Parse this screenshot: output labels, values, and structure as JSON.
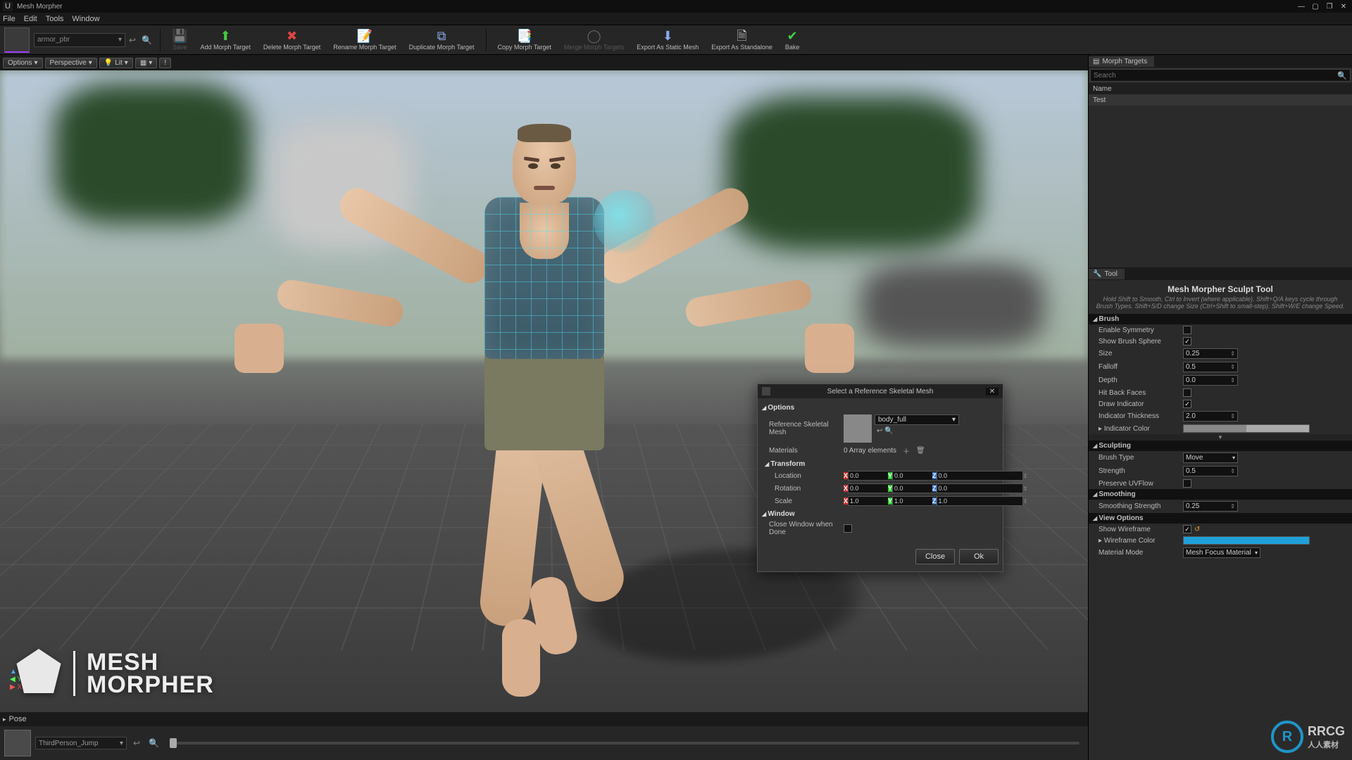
{
  "window": {
    "title": "Mesh Morpher"
  },
  "menubar": {
    "file": "File",
    "edit": "Edit",
    "tools": "Tools",
    "window": "Window"
  },
  "asset": {
    "name": "armor_pbr"
  },
  "toolbar": {
    "save": "Save",
    "add": "Add Morph Target",
    "delete": "Delete Morph Target",
    "rename": "Rename Morph Target",
    "duplicate": "Duplicate Morph Target",
    "copy": "Copy Morph Target",
    "merge": "Merge Morph Targets",
    "export_static": "Export As Static Mesh",
    "export_standalone": "Export As Standalone",
    "bake": "Bake"
  },
  "viewport_bar": {
    "options": "Options",
    "perspective": "Perspective",
    "lit": "Lit"
  },
  "overlay": {
    "logo_line1": "MESH",
    "logo_line2": "MORPHER",
    "axis_z": "Z",
    "axis_y": "Y",
    "axis_x": "X"
  },
  "pose": {
    "label": "Pose"
  },
  "timeline": {
    "anim": "ThirdPerson_Jump"
  },
  "dialog": {
    "title": "Select a Reference Skeletal Mesh",
    "section_options": "Options",
    "ref_label": "Reference Skeletal Mesh",
    "ref_value": "body_full",
    "materials_label": "Materials",
    "materials_value": "0 Array elements",
    "transform_label": "Transform",
    "location_label": "Location",
    "rotation_label": "Rotation",
    "scale_label": "Scale",
    "loc": {
      "x": "0.0",
      "y": "0.0",
      "z": "0.0"
    },
    "rot": {
      "x": "0.0",
      "y": "0.0",
      "z": "0.0"
    },
    "scl": {
      "x": "1.0",
      "y": "1.0",
      "z": "1.0"
    },
    "section_window": "Window",
    "close_done": "Close Window when Done",
    "btn_close": "Close",
    "btn_ok": "Ok"
  },
  "morph_targets": {
    "tab": "Morph Targets",
    "search_placeholder": "Search",
    "column": "Name",
    "items": [
      "Test"
    ]
  },
  "tool_panel": {
    "tab": "Tool",
    "title": "Mesh Morpher Sculpt Tool",
    "hint": "Hold Shift to Smooth, Ctrl to Invert (where applicable). Shift+Q/A keys cycle through Brush Types. Shift+S/D change Size (Ctrl+Shift to small-step). Shift+W/E change Speed.",
    "brush_section": "Brush",
    "enable_symmetry": "Enable Symmetry",
    "show_brush_sphere": "Show Brush Sphere",
    "size_label": "Size",
    "size_value": "0.25",
    "falloff_label": "Falloff",
    "falloff_value": "0.5",
    "depth_label": "Depth",
    "depth_value": "0.0",
    "hit_back_faces": "Hit Back Faces",
    "draw_indicator": "Draw Indicator",
    "indicator_thickness_label": "Indicator Thickness",
    "indicator_thickness_value": "2.0",
    "indicator_color_label": "Indicator Color",
    "sculpting_section": "Sculpting",
    "brush_type_label": "Brush Type",
    "brush_type_value": "Move",
    "strength_label": "Strength",
    "strength_value": "0.5",
    "preserve_uvflow": "Preserve UVFlow",
    "smoothing_section": "Smoothing",
    "smoothing_strength_label": "Smoothing Strength",
    "smoothing_strength_value": "0.25",
    "view_section": "View Options",
    "show_wireframe": "Show Wireframe",
    "wireframe_color": "Wireframe Color",
    "material_mode_label": "Material Mode",
    "material_mode_value": "Mesh Focus Material"
  },
  "watermark": {
    "brand": "RRCG",
    "sub": "人人素材"
  }
}
